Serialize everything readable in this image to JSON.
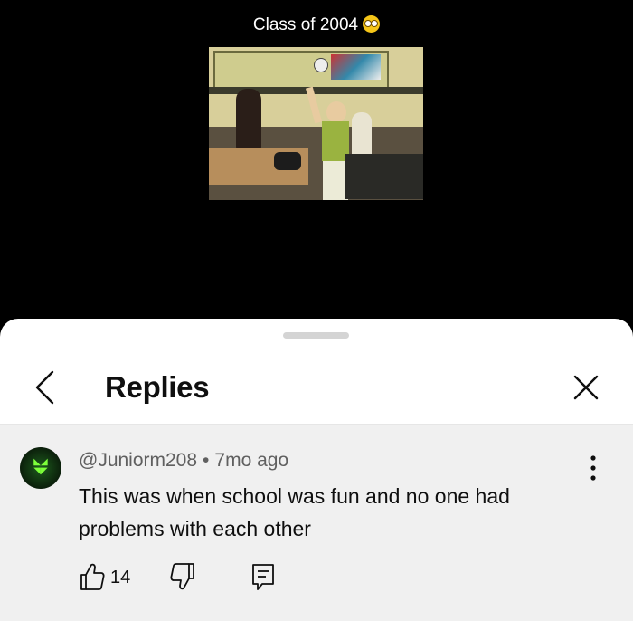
{
  "video": {
    "caption": "Class of 2004",
    "caption_emoji": "pleading-face-emoji"
  },
  "panel": {
    "title": "Replies",
    "back_icon": "chevron-left-icon",
    "close_icon": "close-icon"
  },
  "comment": {
    "author": "@Juniorm208",
    "separator": "•",
    "time": "7mo ago",
    "text": "This was when school was fun and no one had problems with each other",
    "like_count": "14",
    "icons": {
      "more": "more-vertical-icon",
      "like": "thumbs-up-icon",
      "dislike": "thumbs-down-icon",
      "reply": "reply-comment-icon"
    }
  },
  "colors": {
    "background": "#000000",
    "panel": "#ffffff",
    "comment_bg": "#f0f0f0",
    "text_primary": "#0f0f0f",
    "text_secondary": "#606060"
  }
}
